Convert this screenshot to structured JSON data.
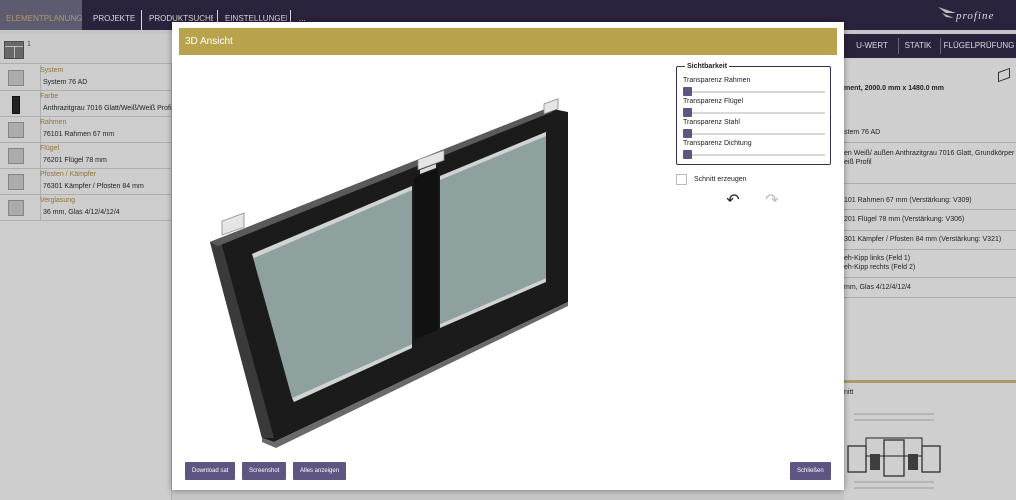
{
  "nav": {
    "tabs": [
      "ELEMENTPLANUNG",
      "PROJEKTE",
      "PRODUKTSUCHE",
      "EINSTELLUNGEN",
      "..."
    ],
    "logo_text": "profine"
  },
  "left_panel": {
    "badge": "1",
    "rows": [
      {
        "label": "System",
        "value": "System 76 AD",
        "icon": "window-profile-icon"
      },
      {
        "label": "Farbe",
        "value": "Anthrazitgrau 7016 Glatt/Weiß/Weiß Profil",
        "icon": "color-swatch-icon"
      },
      {
        "label": "Rahmen",
        "value": "76101 Rahmen 67 mm",
        "icon": "frame-icon"
      },
      {
        "label": "Flügel",
        "value": "76201 Flügel 78 mm",
        "icon": "sash-icon"
      },
      {
        "label": "Pfosten / Kämpfer",
        "value": "76301 Kämpfer / Pfosten 84 mm",
        "icon": "mullion-icon"
      },
      {
        "label": "Verglasung",
        "value": "36 mm, Glas 4/12/4/12/4",
        "icon": "glazing-icon"
      }
    ]
  },
  "right_panel": {
    "tabs": [
      "U-WERT",
      "STATIK",
      "FLÜGELPRÜFUNG"
    ],
    "summary": "ment, 2000.0 mm x 1480.0 mm",
    "lines": [
      "stem 76 AD",
      "en Weiß/ außen Anthrazitgrau 7016 Glatt, Grundkörper",
      "eiß Profil",
      "101 Rahmen 67 mm (Verstärkung: V309)",
      "201 Flügel 78 mm (Verstärkung: V306)",
      "301 Kämpfer / Pfosten 84 mm (Verstärkung: V321)",
      "eh-Kipp links (Feld 1)",
      "eh-Kipp rechts (Feld 2)",
      "mm, Glas 4/12/4/12/4"
    ],
    "section": "nitt"
  },
  "modal": {
    "title": "3D Ansicht",
    "visibility": {
      "legend": "Sichtbarkeit",
      "sliders": [
        {
          "label": "Transparenz Rahmen",
          "value": 0
        },
        {
          "label": "Transparenz Flügel",
          "value": 0
        },
        {
          "label": "Transparenz Stahl",
          "value": 0
        },
        {
          "label": "Transparenz Dichtung",
          "value": 0
        }
      ]
    },
    "checkbox_label": "Schnitt erzeugen",
    "undo_glyph": "↶",
    "redo_glyph": "↷",
    "buttons": {
      "download": "Download sat",
      "screenshot": "Screenshot",
      "show_all": "Alles anzeigen",
      "close": "Schließen"
    }
  },
  "colors": {
    "nav_bg": "#2c2342",
    "gold": "#b8a24b",
    "button": "#5e5582",
    "frame": "#1a1a1a",
    "glass": "#8fa19f"
  }
}
